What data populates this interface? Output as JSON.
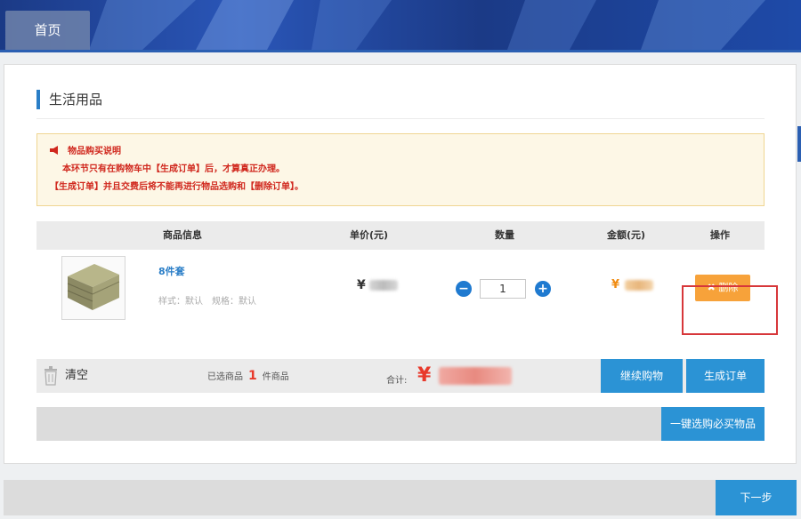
{
  "header": {
    "home_tab": "首页"
  },
  "section": {
    "title": "生活用品"
  },
  "notice": {
    "title": "物品购买说明",
    "line1": "本环节只有在购物车中【生成订单】后，才算真正办理。",
    "line2": "【生成订单】并且交费后将不能再进行物品选购和【删除订单】。"
  },
  "table": {
    "headers": [
      "商品信息",
      "单价(元)",
      "数量",
      "金额(元)",
      "操作"
    ]
  },
  "item": {
    "name": "8件套",
    "spec": "样式：默认　规格：默认",
    "price_symbol": "¥",
    "quantity": "1",
    "minus": "−",
    "plus": "+",
    "amount_symbol": "¥",
    "delete_label": "✖ 删除"
  },
  "summary": {
    "clear_label": "清空",
    "selected_prefix": "已选商品",
    "selected_count": "1",
    "selected_suffix": "件商品",
    "total_label": "合计:",
    "total_symbol": "¥",
    "continue_label": "继续购物",
    "order_label": "生成订单"
  },
  "onekey": {
    "label": "一键选购必买物品"
  },
  "footer": {
    "next_label": "下一步"
  },
  "colors": {
    "accent": "#2b93d5",
    "warning": "#d0271d",
    "price": "#e8392b",
    "delete": "#f7a23a",
    "highlight": "#d7373a"
  }
}
